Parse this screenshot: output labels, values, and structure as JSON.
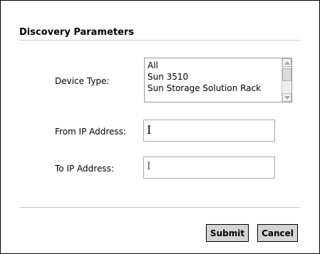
{
  "form": {
    "title": "Discovery Parameters",
    "device_type_label": "Device Type:",
    "device_types": [
      "All",
      "Sun 3510",
      "Sun Storage Solution Rack"
    ],
    "from_ip_label": "From IP Address:",
    "from_ip_value": "",
    "to_ip_label": "To IP Address:",
    "to_ip_value": "",
    "submit_label": "Submit",
    "cancel_label": "Cancel"
  },
  "icons": {
    "scroll_up": "scroll-up-arrow-icon",
    "scroll_down": "scroll-down-arrow-icon",
    "text_cursor": "text-cursor-icon"
  },
  "colors": {
    "button_bg": "#d4d4d4",
    "rule": "#cfcfcf",
    "input_border": "#a8a8a8"
  }
}
